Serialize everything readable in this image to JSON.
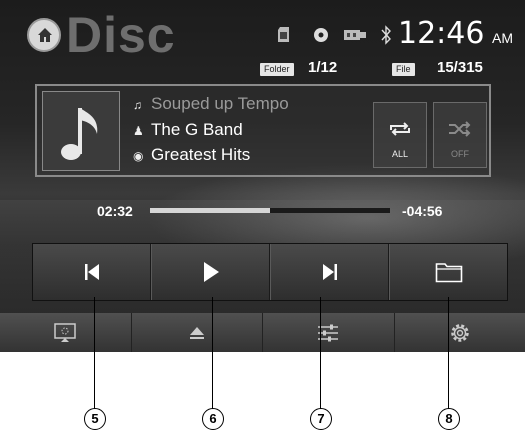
{
  "header": {
    "title": "Disc",
    "time": "12:46",
    "ampm": "AM",
    "status_icons": [
      "sd-card-icon",
      "disc-icon",
      "usb-icon",
      "bluetooth-icon"
    ]
  },
  "position": {
    "folder_label": "Folder",
    "folder_value": "1/12",
    "file_label": "File",
    "file_value": "15/315"
  },
  "track": {
    "title": "Souped up Tempo",
    "artist": "The G Band",
    "album": "Greatest Hits"
  },
  "modes": {
    "repeat_label": "ALL",
    "shuffle_label": "OFF"
  },
  "progress": {
    "elapsed": "02:32",
    "remaining": "-04:56",
    "fraction": 0.5
  },
  "controls": [
    "previous-icon",
    "play-icon",
    "next-icon",
    "folder-icon"
  ],
  "bottom_bar": [
    "display-icon",
    "eject-icon",
    "equalizer-icon",
    "settings-icon"
  ],
  "callouts": [
    "5",
    "6",
    "7",
    "8"
  ]
}
